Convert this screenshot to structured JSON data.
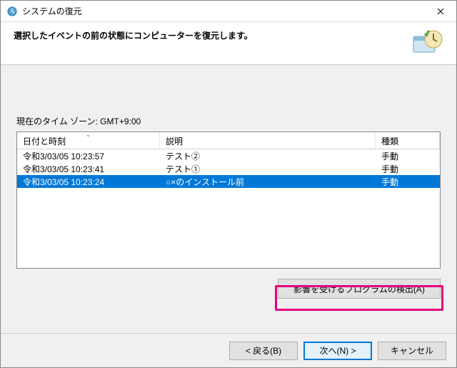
{
  "window": {
    "title": "システムの復元"
  },
  "header": {
    "heading": "選択したイベントの前の状態にコンピューターを復元します。"
  },
  "timezone_label": "現在のタイム ゾーン: GMT+9:00",
  "columns": {
    "date": "日付と時刻",
    "desc": "説明",
    "type": "種類"
  },
  "rows": [
    {
      "date": "令和3/03/05 10:23:57",
      "desc": "テスト②",
      "type": "手動",
      "selected": false
    },
    {
      "date": "令和3/03/05 10:23:41",
      "desc": "テスト①",
      "type": "手動",
      "selected": false
    },
    {
      "date": "令和3/03/05 10:23:24",
      "desc": "○×のインストール前",
      "type": "手動",
      "selected": true
    }
  ],
  "buttons": {
    "scan": "影響を受けるプログラムの検出(A)",
    "back": "< 戻る(B)",
    "next": "次へ(N) >",
    "cancel": "キャンセル"
  }
}
